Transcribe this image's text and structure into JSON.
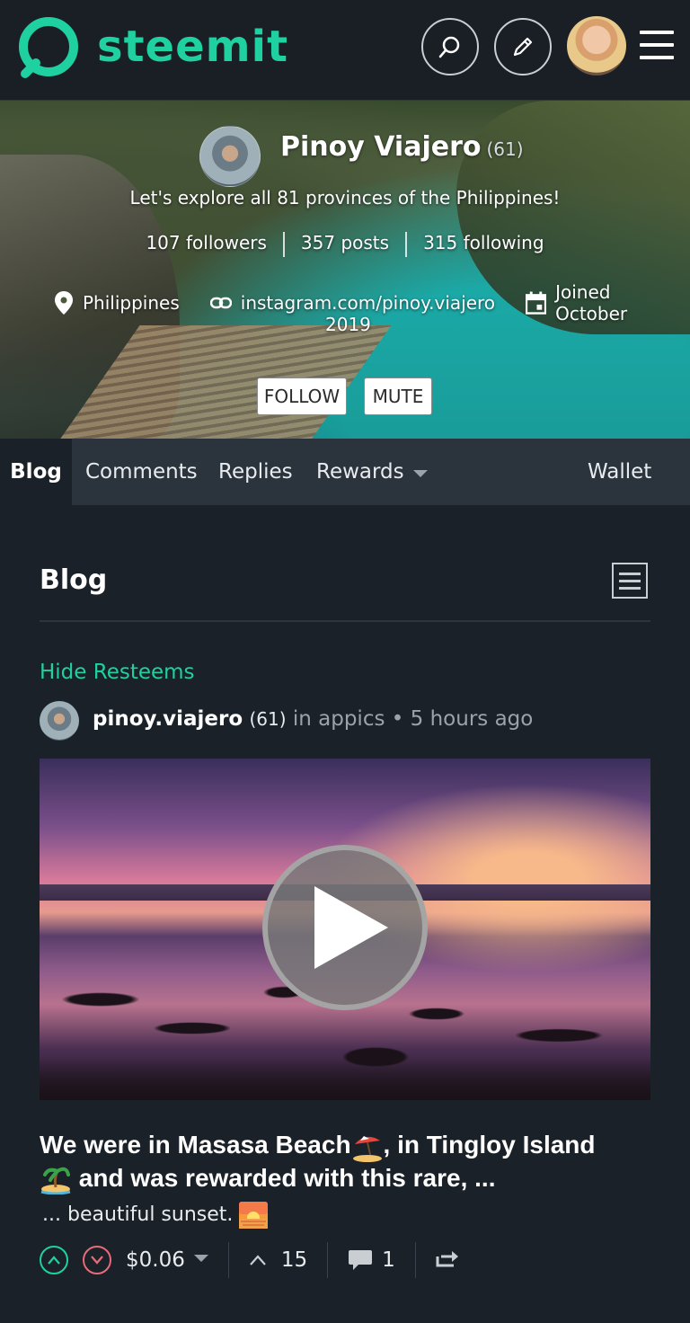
{
  "header": {
    "logo_text": "steemit"
  },
  "profile": {
    "name": "Pinoy Viajero",
    "reputation": "(61)",
    "about": "Let's explore all 81 provinces of the Philippines!",
    "followers": "107 followers",
    "posts": "357 posts",
    "following": "315 following",
    "location": "Philippines",
    "website": "instagram.com/pinoy.viajero",
    "joined": "Joined October",
    "joined_year": "2019",
    "follow_label": "FOLLOW",
    "mute_label": "MUTE"
  },
  "tabs": {
    "blog": "Blog",
    "comments": "Comments",
    "replies": "Replies",
    "rewards": "Rewards",
    "wallet": "Wallet"
  },
  "blog": {
    "title": "Blog",
    "hide_resteems": "Hide Resteems"
  },
  "post": {
    "author": "pinoy.viajero",
    "reputation": "(61)",
    "community_prefix": "in appics",
    "time": "5 hours ago",
    "title_part1": "We were in Masasa Beach",
    "title_part2": ", in Tingloy Island",
    "title_part3": " and was rewarded with this rare, ...",
    "summary": "... beautiful sunset.",
    "payout": "$0.06",
    "votes": "15",
    "comments": "1"
  },
  "colors": {
    "accent": "#1fd1a1",
    "downvote": "#e86b7a",
    "background": "#1b2128",
    "tabbar": "#2b333c"
  }
}
